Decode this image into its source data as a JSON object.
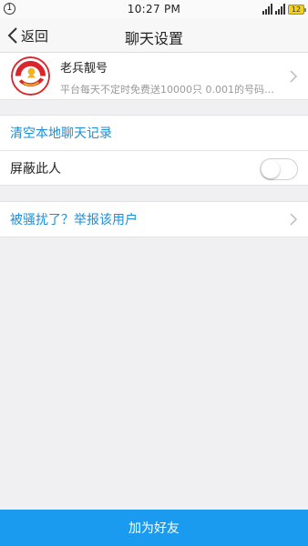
{
  "status_bar": {
    "notification_badge": "1",
    "time": "10:27 PM",
    "battery": "12"
  },
  "nav": {
    "back_label": "返回",
    "title": "聊天设置"
  },
  "profile": {
    "name": "老兵靓号",
    "signature": "平台每天不定时免费送10000只 0.001的号码…",
    "avatar_colors": {
      "ring": "#d8262c",
      "accent": "#f2b21c"
    }
  },
  "actions": {
    "clear_history": "清空本地聊天记录",
    "block_label": "屏蔽此人",
    "block_enabled": false,
    "report": "被骚扰了？举报该用户"
  },
  "footer": {
    "add_friend": "加为好友"
  },
  "colors": {
    "link": "#1c8fd6",
    "primary_button": "#1a9bf0"
  }
}
